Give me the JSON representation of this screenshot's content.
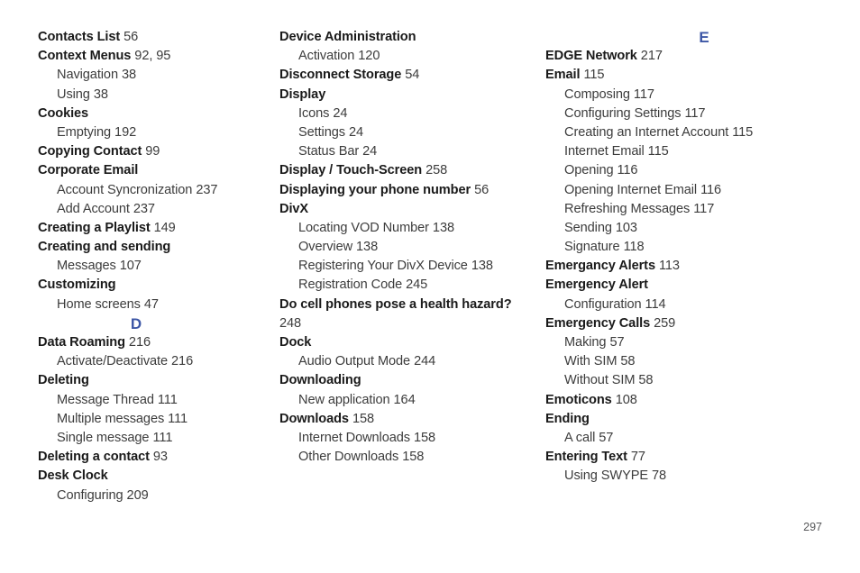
{
  "page": {
    "page_number": "297",
    "section_letter_color": "#3d57a6",
    "text_color": "#231f20"
  },
  "columns": [
    {
      "name": "column-1",
      "entries": [
        {
          "kind": "main",
          "title": "Contacts List",
          "page": "56"
        },
        {
          "kind": "main",
          "title": "Context Menus",
          "page": "92, 95"
        },
        {
          "kind": "sub",
          "title": "Navigation",
          "page": "38"
        },
        {
          "kind": "sub",
          "title": "Using",
          "page": "38"
        },
        {
          "kind": "main",
          "title": "Cookies",
          "page": ""
        },
        {
          "kind": "sub",
          "title": "Emptying",
          "page": "192"
        },
        {
          "kind": "main",
          "title": "Copying Contact",
          "page": "99"
        },
        {
          "kind": "main",
          "title": "Corporate Email",
          "page": ""
        },
        {
          "kind": "sub",
          "title": "Account Syncronization",
          "page": "237"
        },
        {
          "kind": "sub",
          "title": "Add Account",
          "page": "237"
        },
        {
          "kind": "main",
          "title": "Creating a Playlist",
          "page": "149"
        },
        {
          "kind": "main",
          "title": "Creating and sending",
          "page": ""
        },
        {
          "kind": "sub",
          "title": "Messages",
          "page": "107"
        },
        {
          "kind": "main",
          "title": "Customizing",
          "page": ""
        },
        {
          "kind": "sub",
          "title": "Home screens",
          "page": "47"
        },
        {
          "kind": "letter",
          "title": "D",
          "page": ""
        },
        {
          "kind": "main",
          "title": "Data Roaming",
          "page": "216"
        },
        {
          "kind": "sub",
          "title": "Activate/Deactivate",
          "page": "216"
        },
        {
          "kind": "main",
          "title": "Deleting",
          "page": ""
        },
        {
          "kind": "sub",
          "title": "Message Thread",
          "page": "111"
        },
        {
          "kind": "sub",
          "title": "Multiple messages",
          "page": "111"
        },
        {
          "kind": "sub",
          "title": "Single message",
          "page": "111"
        },
        {
          "kind": "main",
          "title": "Deleting a contact",
          "page": "93"
        },
        {
          "kind": "main",
          "title": "Desk Clock",
          "page": ""
        },
        {
          "kind": "sub",
          "title": "Configuring",
          "page": "209"
        }
      ]
    },
    {
      "name": "column-2",
      "entries": [
        {
          "kind": "main",
          "title": "Device Administration",
          "page": ""
        },
        {
          "kind": "sub",
          "title": "Activation",
          "page": "120"
        },
        {
          "kind": "main",
          "title": "Disconnect Storage",
          "page": "54"
        },
        {
          "kind": "main",
          "title": "Display",
          "page": ""
        },
        {
          "kind": "sub",
          "title": "Icons",
          "page": "24"
        },
        {
          "kind": "sub",
          "title": "Settings",
          "page": "24"
        },
        {
          "kind": "sub",
          "title": "Status Bar",
          "page": "24"
        },
        {
          "kind": "main",
          "title": "Display / Touch-Screen",
          "page": "258"
        },
        {
          "kind": "main",
          "title": "Displaying your phone number",
          "page": "56"
        },
        {
          "kind": "main",
          "title": "DivX",
          "page": ""
        },
        {
          "kind": "sub",
          "title": "Locating VOD Number",
          "page": "138"
        },
        {
          "kind": "sub",
          "title": "Overview",
          "page": "138"
        },
        {
          "kind": "sub",
          "title": "Registering Your DivX Device",
          "page": "138"
        },
        {
          "kind": "sub",
          "title": "Registration Code",
          "page": "245"
        },
        {
          "kind": "main",
          "title": "Do cell phones pose a health hazard?",
          "page": ""
        },
        {
          "kind": "wrapcont",
          "title": "248",
          "page": ""
        },
        {
          "kind": "main",
          "title": "Dock",
          "page": ""
        },
        {
          "kind": "sub",
          "title": "Audio Output Mode",
          "page": "244"
        },
        {
          "kind": "main",
          "title": "Downloading",
          "page": ""
        },
        {
          "kind": "sub",
          "title": "New application",
          "page": "164"
        },
        {
          "kind": "main",
          "title": "Downloads",
          "page": "158"
        },
        {
          "kind": "sub",
          "title": "Internet Downloads",
          "page": "158"
        },
        {
          "kind": "sub",
          "title": "Other Downloads",
          "page": "158"
        }
      ]
    },
    {
      "name": "column-3",
      "entries": [
        {
          "kind": "letter",
          "title": "E",
          "page": ""
        },
        {
          "kind": "main",
          "title": "EDGE Network",
          "page": "217"
        },
        {
          "kind": "main",
          "title": "Email",
          "page": "115"
        },
        {
          "kind": "sub",
          "title": "Composing",
          "page": "117"
        },
        {
          "kind": "sub",
          "title": "Configuring Settings",
          "page": "117"
        },
        {
          "kind": "sub",
          "title": "Creating an Internet Account",
          "page": "115"
        },
        {
          "kind": "sub",
          "title": "Internet Email",
          "page": "115"
        },
        {
          "kind": "sub",
          "title": "Opening",
          "page": "116"
        },
        {
          "kind": "sub",
          "title": "Opening Internet Email",
          "page": "116"
        },
        {
          "kind": "sub",
          "title": "Refreshing Messages",
          "page": "117"
        },
        {
          "kind": "sub",
          "title": "Sending",
          "page": "103"
        },
        {
          "kind": "sub",
          "title": "Signature",
          "page": "118"
        },
        {
          "kind": "main",
          "title": "Emergancy Alerts",
          "page": "113"
        },
        {
          "kind": "main",
          "title": "Emergency Alert",
          "page": ""
        },
        {
          "kind": "sub",
          "title": "Configuration",
          "page": "114"
        },
        {
          "kind": "main",
          "title": "Emergency Calls",
          "page": "259"
        },
        {
          "kind": "sub",
          "title": "Making",
          "page": "57"
        },
        {
          "kind": "sub",
          "title": "With SIM",
          "page": "58"
        },
        {
          "kind": "sub",
          "title": "Without SIM",
          "page": "58"
        },
        {
          "kind": "main",
          "title": "Emoticons",
          "page": "108"
        },
        {
          "kind": "main",
          "title": "Ending",
          "page": ""
        },
        {
          "kind": "sub",
          "title": "A call",
          "page": "57"
        },
        {
          "kind": "main",
          "title": "Entering Text",
          "page": "77"
        },
        {
          "kind": "sub",
          "title": "Using SWYPE",
          "page": "78"
        }
      ]
    }
  ]
}
